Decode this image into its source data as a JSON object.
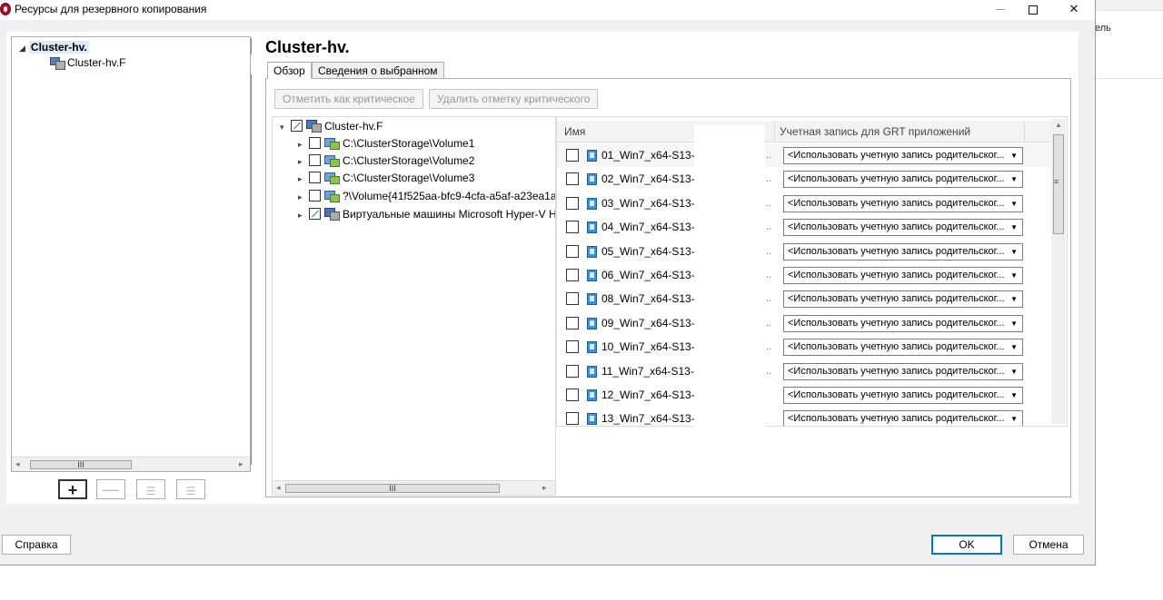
{
  "background_window": {
    "partial_text": "ель"
  },
  "window": {
    "title": "Ресурсы для резервного копирования",
    "controls": {
      "minimize": "—",
      "maximize": "□",
      "close": "✕"
    }
  },
  "left_tree": {
    "root": "Cluster-hv.",
    "child": "Cluster-hv.F",
    "scroll_thumb": "III"
  },
  "toolbar": {
    "add": "+",
    "remove": "—"
  },
  "details": {
    "title": "Cluster-hv.",
    "tabs": [
      {
        "label": "Обзор",
        "active": true
      },
      {
        "label": "Сведения о выбранном",
        "active": false
      }
    ],
    "mark_critical_label": "Отметить как критическое",
    "unmark_critical_label": "Удалить отметку критического"
  },
  "resource_tree": {
    "root": "Cluster-hv.F",
    "items": [
      {
        "label": "C:\\ClusterStorage\\Volume1",
        "checked": false
      },
      {
        "label": "C:\\ClusterStorage\\Volume2",
        "checked": false
      },
      {
        "label": "C:\\ClusterStorage\\Volume3",
        "checked": false
      },
      {
        "label": "?\\Volume{41f525aa-bfc9-4cfa-a5af-a23ea1a",
        "checked": false
      },
      {
        "label": "Виртуальные машины Microsoft Hyper-V H",
        "checked": "partial"
      }
    ],
    "scroll_thumb": "III"
  },
  "vm_grid": {
    "columns": [
      "Имя",
      "Учетная запись для GRT приложений"
    ],
    "rows": [
      {
        "name": "01_Win7_x64-S13-(",
        "dots": "..",
        "account": "<Использовать учетную запись родительског..."
      },
      {
        "name": "02_Win7_x64-S13-(",
        "dots": "..",
        "account": "<Использовать учетную запись родительског..."
      },
      {
        "name": "03_Win7_x64-S13-(",
        "dots": "..",
        "account": "<Использовать учетную запись родительског..."
      },
      {
        "name": "04_Win7_x64-S13-(",
        "dots": "..",
        "account": "<Использовать учетную запись родительског..."
      },
      {
        "name": "05_Win7_x64-S13-(",
        "dots": "..",
        "account": "<Использовать учетную запись родительског..."
      },
      {
        "name": "06_Win7_x64-S13-(",
        "dots": "..",
        "account": "<Использовать учетную запись родительског..."
      },
      {
        "name": "08_Win7_x64-S13-(",
        "dots": "..",
        "account": "<Использовать учетную запись родительског..."
      },
      {
        "name": "09_Win7_x64-S13-(",
        "dots": "..",
        "account": "<Использовать учетную запись родительског..."
      },
      {
        "name": "10_Win7_x64-S13-(",
        "dots": "..",
        "account": "<Использовать учетную запись родительског..."
      },
      {
        "name": "11_Win7_x64-S13-(",
        "dots": "..",
        "account": "<Использовать учетную запись родительског..."
      },
      {
        "name": "12_Win7_x64-S13-/",
        "dots": "",
        "account": "<Использовать учетную запись родительског..."
      },
      {
        "name": "13_Win7_x64-S13-/",
        "dots": "",
        "account": "<Использовать учетную запись родительског..."
      }
    ]
  },
  "footer": {
    "help": "Справка",
    "ok": "OK",
    "cancel": "Отмена"
  }
}
